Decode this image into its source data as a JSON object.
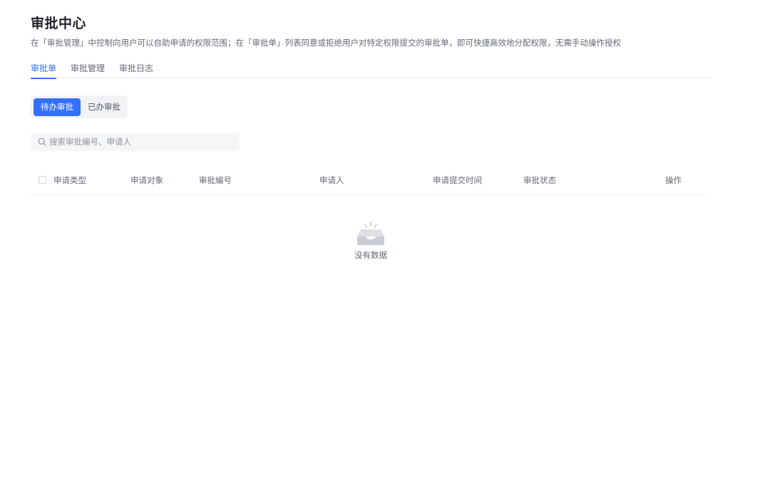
{
  "header": {
    "title": "审批中心",
    "description": "在「审批管理」中控制向用户可以自助申请的权限范围；在「审批单」列表同意或拒绝用户对特定权限提交的审批单，即可快捷高效地分配权限，无需手动操作授权"
  },
  "tabs": [
    {
      "label": "审批单",
      "active": true
    },
    {
      "label": "审批管理",
      "active": false
    },
    {
      "label": "审批日志",
      "active": false
    }
  ],
  "filter": {
    "pending_label": "待办审批",
    "done_label": "已办审批"
  },
  "search": {
    "placeholder": "搜索审批编号、申请人",
    "value": ""
  },
  "table": {
    "columns": [
      "申请类型",
      "申请对象",
      "审批编号",
      "申请人",
      "申请提交时间",
      "审批状态",
      "操作"
    ],
    "rows": [],
    "empty_text": "没有数据"
  },
  "colors": {
    "accent": "#3370ff",
    "text_secondary": "#646a73"
  },
  "icons": {
    "search": "search-icon",
    "empty": "empty-inbox-icon"
  }
}
